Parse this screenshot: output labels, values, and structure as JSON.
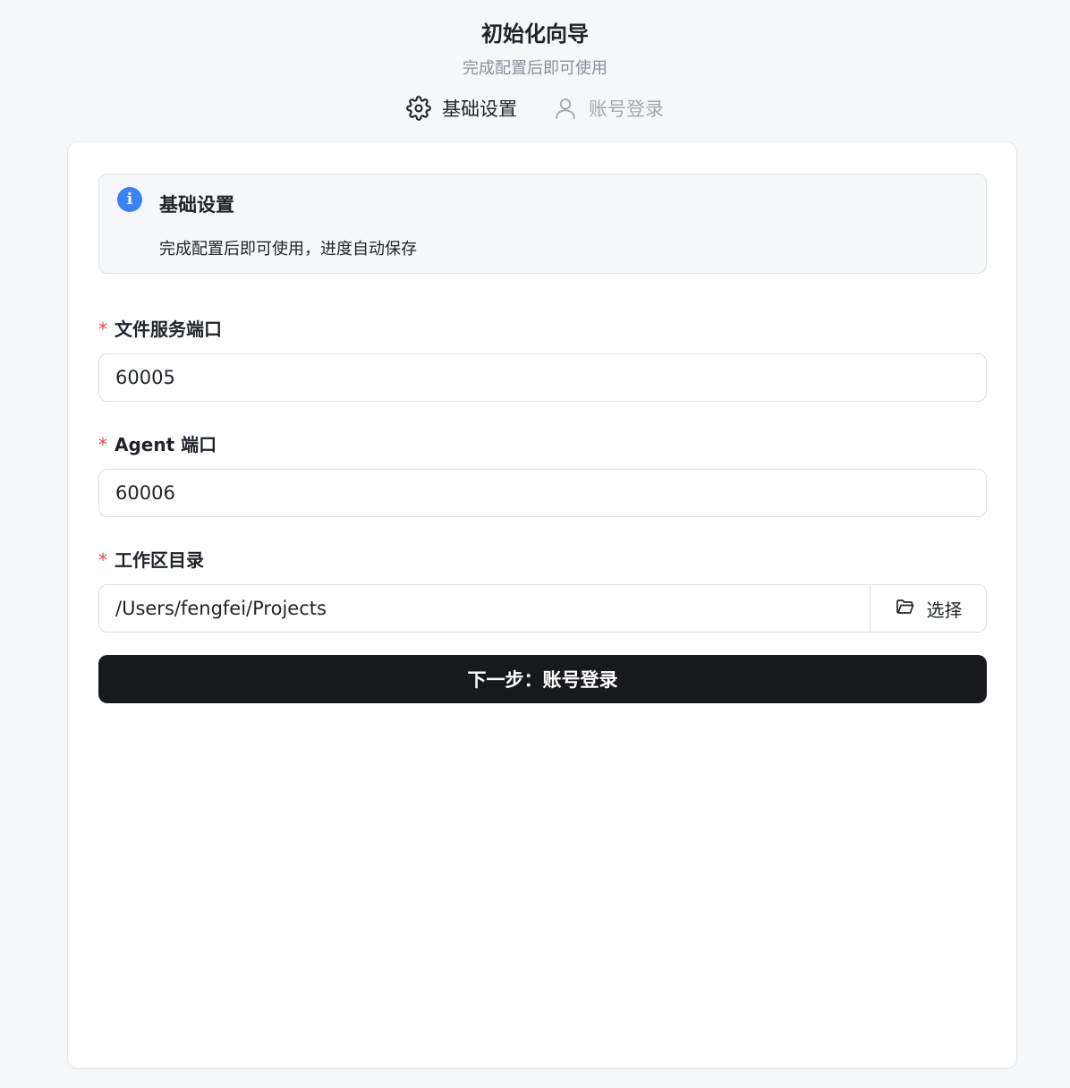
{
  "header": {
    "title": "初始化向导",
    "subtitle": "完成配置后即可使用"
  },
  "steps": [
    {
      "label": "基础设置",
      "icon": "gear-icon",
      "state": "active"
    },
    {
      "label": "账号登录",
      "icon": "user-icon",
      "state": "inactive"
    }
  ],
  "alert": {
    "icon": "info-icon",
    "icon_glyph": "i",
    "title": "基础设置",
    "description": "完成配置后即可使用，进度自动保存"
  },
  "form": {
    "required_mark": "*",
    "file_port": {
      "label": "文件服务端口",
      "value": "60005"
    },
    "agent_port": {
      "label": "Agent 端口",
      "value": "60006"
    },
    "workspace": {
      "label": "工作区目录",
      "value": "/Users/fengfei/Projects",
      "select_label": "选择"
    },
    "next_button": "下一步：账号登录"
  },
  "colors": {
    "accent": "#3b82f6",
    "required": "#e5484d",
    "primary_button": "#18191d",
    "muted_text": "#8a8f99"
  }
}
